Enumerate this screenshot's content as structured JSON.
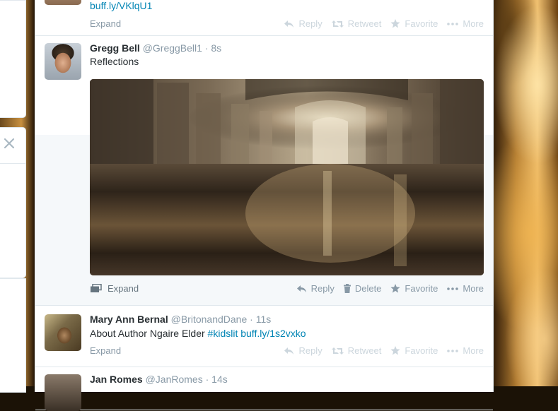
{
  "tweets": [
    {
      "text_link": "buff.ly/VKlqU1",
      "expand_label": "Expand",
      "actions": [
        "Reply",
        "Retweet",
        "Favorite",
        "More"
      ]
    },
    {
      "fullname": "Gregg Bell",
      "username": "@GreggBell1",
      "time": "· 8s",
      "text": "Reflections",
      "expand_label": "Expand",
      "actions": [
        "Reply",
        "Delete",
        "Favorite",
        "More"
      ]
    },
    {
      "fullname": "Mary Ann Bernal",
      "username": "@BritonandDane",
      "time": "· 11s",
      "text_plain": "About Author Ngaire Elder ",
      "hashtag": "#kidslit",
      "text_link": "buff.ly/1s2vxko",
      "expand_label": "Expand",
      "actions": [
        "Reply",
        "Retweet",
        "Favorite",
        "More"
      ]
    },
    {
      "fullname": "Jan Romes",
      "username": "@JanRomes",
      "time": "· 14s"
    }
  ],
  "icons": {
    "close": "close-icon",
    "reply": "reply-icon",
    "retweet": "retweet-icon",
    "favorite": "star-icon",
    "more": "more-dots-icon",
    "delete": "trash-icon",
    "expand": "media-expand-icon"
  },
  "colors": {
    "link": "#0084b4",
    "muted": "#8899a6",
    "faded": "#ccd6dd",
    "text": "#292f33"
  }
}
